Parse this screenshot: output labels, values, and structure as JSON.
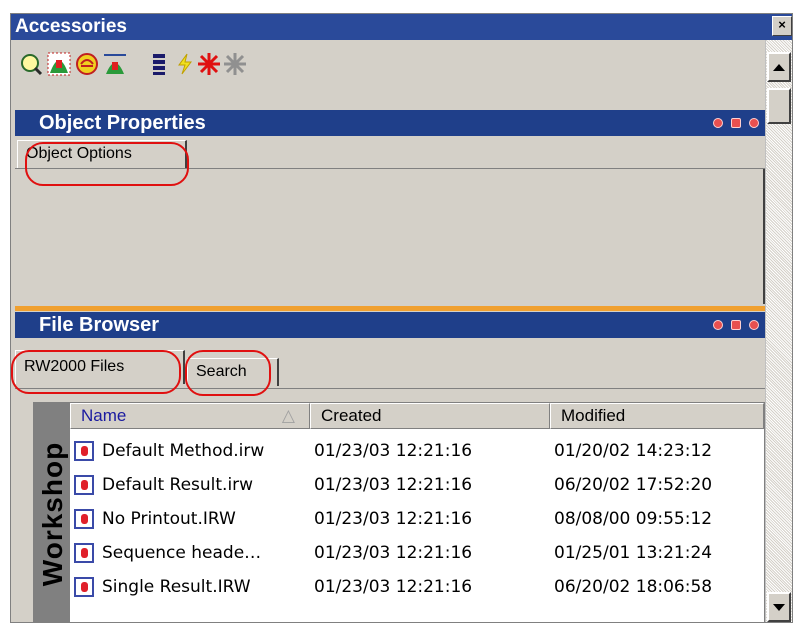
{
  "window": {
    "title": "Accessories",
    "close_label": "×"
  },
  "toolbar": {
    "icons": [
      "magnify-icon",
      "peak-icon",
      "no-entry-icon",
      "peak-width-icon",
      "stack-icon",
      "lightning-icon",
      "red-star-icon",
      "gray-star-icon"
    ],
    "accent": "#e01010"
  },
  "object_properties": {
    "title": "Object Properties",
    "tabs": [
      "Object Options"
    ]
  },
  "file_browser": {
    "title": "File Browser",
    "tabs": [
      "RW2000 Files",
      "Search"
    ],
    "side_label": "Workshop",
    "columns": [
      "Name",
      "Created",
      "Modified"
    ],
    "sort_indicator": "△",
    "rows": [
      {
        "name": "Default Method.irw",
        "created": "01/23/03 12:21:16",
        "modified": "01/20/02 14:23:12"
      },
      {
        "name": "Default Result.irw",
        "created": "01/23/03 12:21:16",
        "modified": "06/20/02 17:52:20"
      },
      {
        "name": "No Printout.IRW",
        "created": "01/23/03 12:21:16",
        "modified": "08/08/00 09:55:12"
      },
      {
        "name": "Sequence heade…",
        "created": "01/23/03 12:21:16",
        "modified": "01/25/01 13:21:24"
      },
      {
        "name": "Single Result.IRW",
        "created": "01/23/03 12:21:16",
        "modified": "06/20/02 18:06:58"
      }
    ]
  },
  "colors": {
    "titlebar": "#2a4a9a",
    "panel_header": "#1f3f8a",
    "divider": "#f0a030",
    "annotation": "#e01010"
  }
}
